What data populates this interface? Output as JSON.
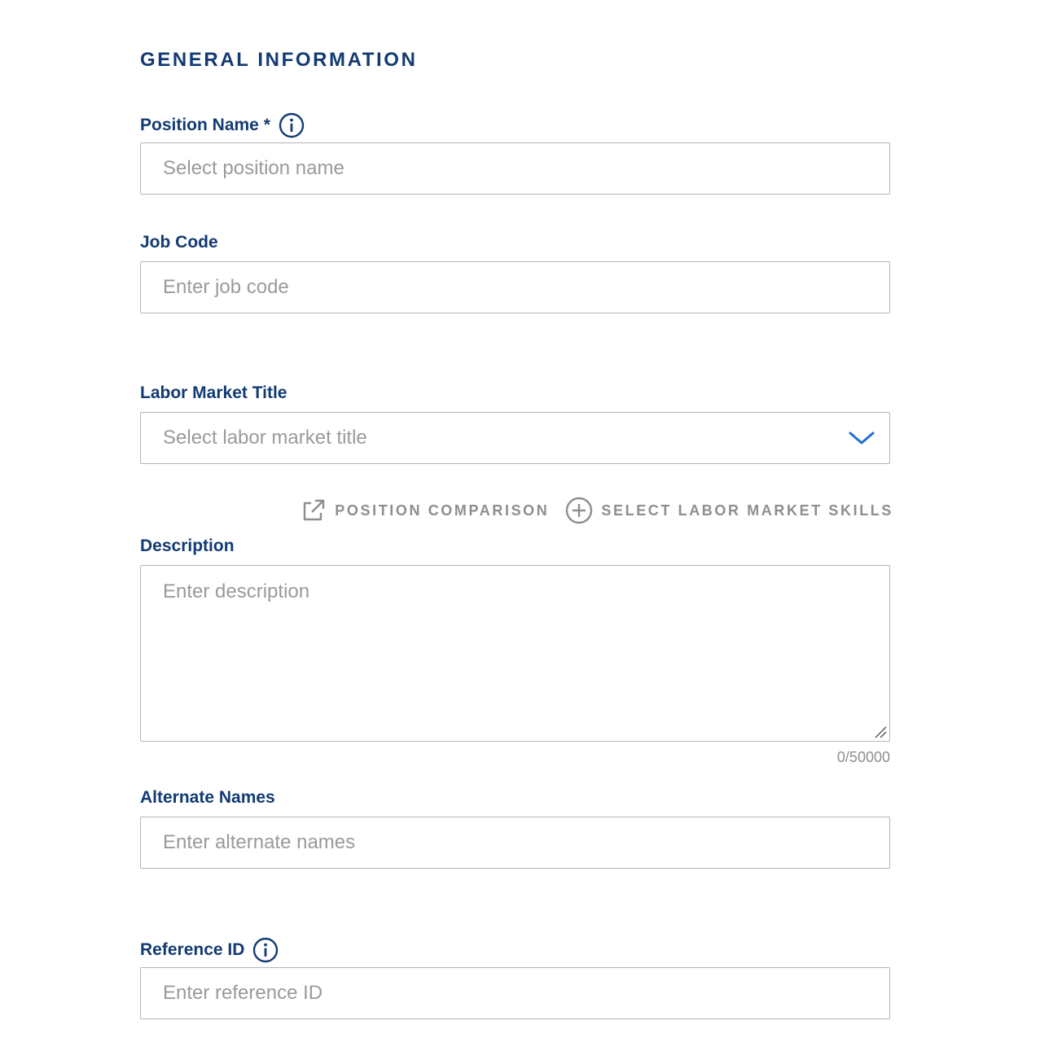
{
  "section": {
    "title": "GENERAL INFORMATION"
  },
  "fields": {
    "position_name": {
      "label": "Position Name *",
      "placeholder": "Select position name",
      "icon": "info-icon"
    },
    "job_code": {
      "label": "Job Code",
      "placeholder": "Enter job code"
    },
    "labor_market_title": {
      "label": "Labor Market Title",
      "placeholder": "Select labor market title",
      "icon": "chevron-down-icon"
    },
    "description": {
      "label": "Description",
      "placeholder": "Enter description",
      "counter": "0/50000"
    },
    "alternate_names": {
      "label": "Alternate Names",
      "placeholder": "Enter alternate names"
    },
    "reference_id": {
      "label": "Reference ID",
      "placeholder": "Enter reference ID",
      "icon": "info-icon"
    }
  },
  "actions": {
    "position_comparison": {
      "label": "POSITION COMPARISON",
      "icon": "external-link-icon"
    },
    "select_skills": {
      "label": "SELECT LABOR MARKET SKILLS",
      "icon": "plus-circle-icon"
    }
  },
  "colors": {
    "primary": "#123a73",
    "accent": "#1f6fd1",
    "border": "#b5b5b5",
    "muted": "#8e8e8e",
    "placeholder": "#9a9a9a"
  }
}
